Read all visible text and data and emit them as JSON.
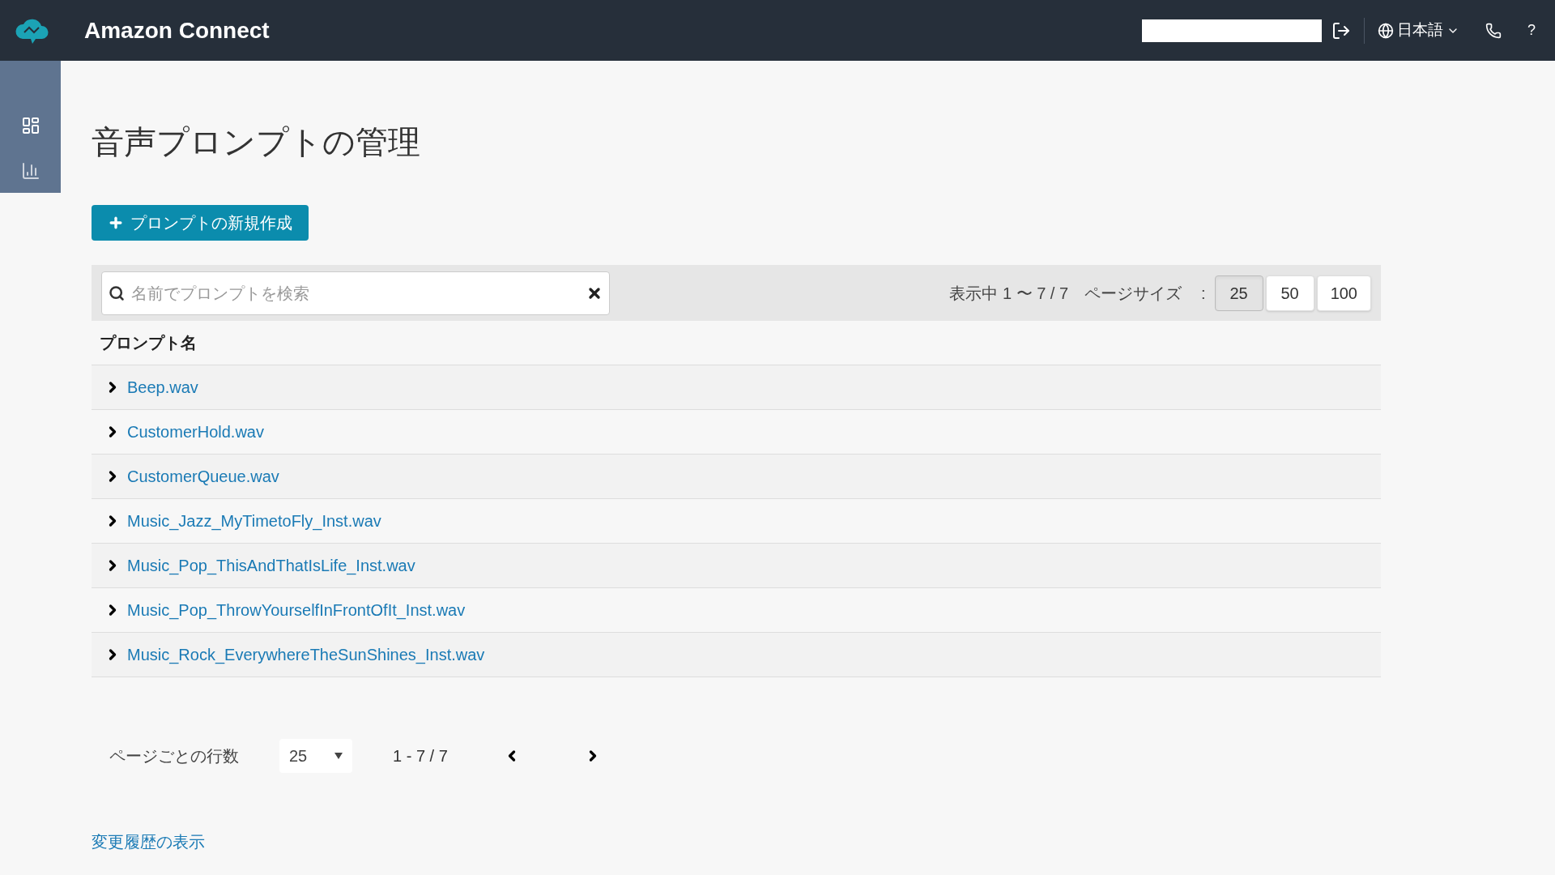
{
  "header": {
    "brand": "Amazon Connect",
    "language": "日本語",
    "help": "?"
  },
  "sidebar": {
    "items": [
      {
        "kind": "dashboard",
        "selected": true
      },
      {
        "kind": "metrics",
        "selected": false
      }
    ]
  },
  "page": {
    "title": "音声プロンプトの管理",
    "create_button": "プロンプトの新規作成"
  },
  "toolbar": {
    "search": {
      "placeholder": "名前でプロンプトを検索"
    },
    "showing": "表示中 1 〜 7 / 7",
    "page_size_label": "ページサイズ",
    "colon": ":",
    "page_sizes": [
      {
        "label": "25",
        "selected": true
      },
      {
        "label": "50",
        "selected": false
      },
      {
        "label": "100",
        "selected": false
      }
    ]
  },
  "table": {
    "columns": [
      "プロンプト名"
    ],
    "rows": [
      {
        "name": "Beep.wav",
        "expanded": false
      },
      {
        "name": "CustomerHold.wav",
        "expanded": false
      },
      {
        "name": "CustomerQueue.wav",
        "expanded": false
      },
      {
        "name": "Music_Jazz_MyTimetoFly_Inst.wav",
        "expanded": false
      },
      {
        "name": "Music_Pop_ThisAndThatIsLife_Inst.wav",
        "expanded": false
      },
      {
        "name": "Music_Pop_ThrowYourselfInFrontOfIt_Inst.wav",
        "expanded": false
      },
      {
        "name": "Music_Rock_EverywhereTheSunShines_Inst.wav",
        "expanded": false
      }
    ]
  },
  "pagination": {
    "rows_per_page_label": "ページごとの行数",
    "rows_per_page": "25",
    "range": "1 - 7 / 7"
  },
  "history_link": "変更履歴の表示"
}
